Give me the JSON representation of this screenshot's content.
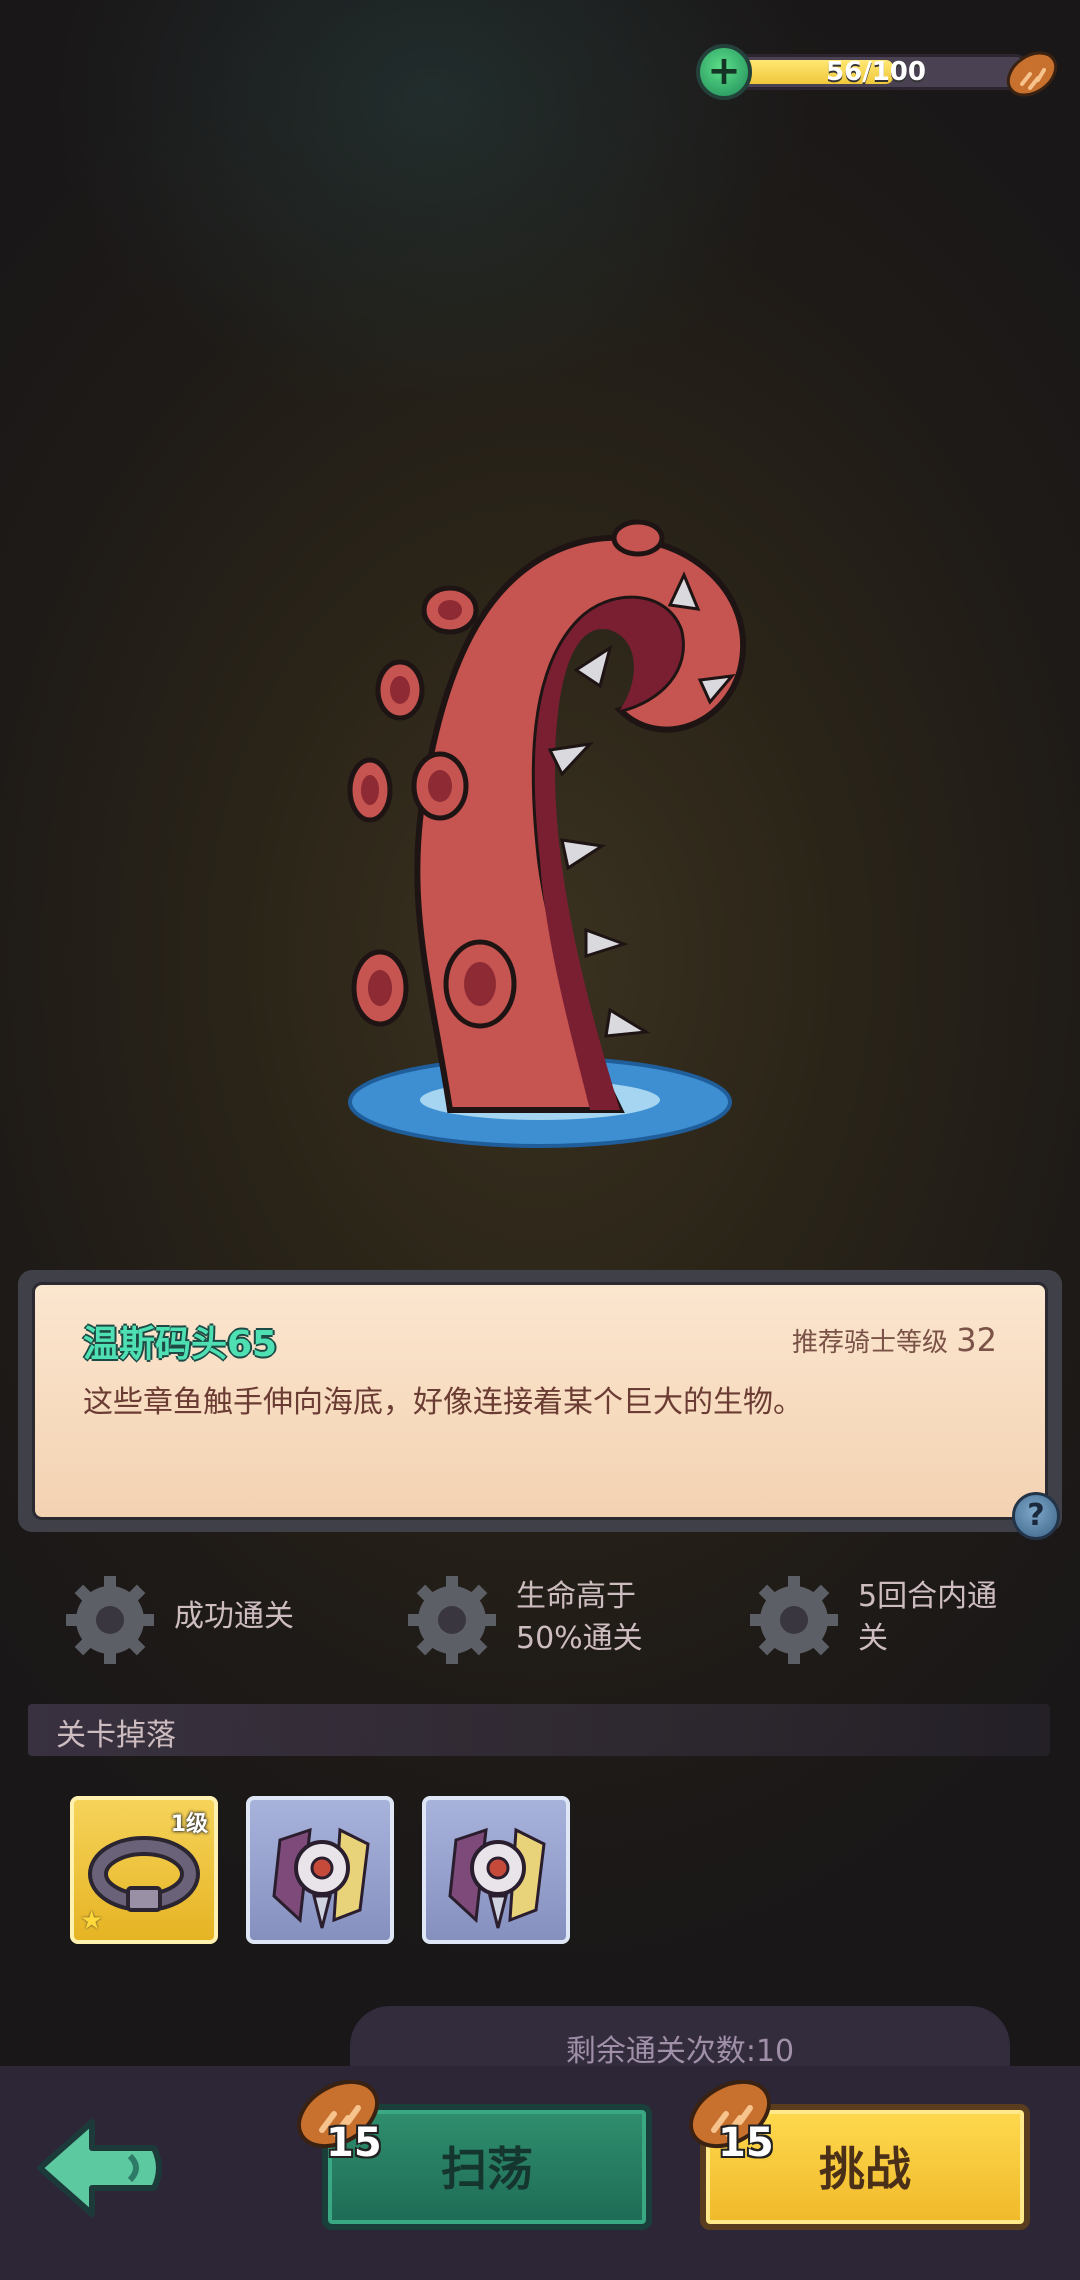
{
  "stamina": {
    "value_text": "56/100",
    "current": 56,
    "max": 100,
    "plus_label": "+"
  },
  "stage": {
    "name": "温斯码头65",
    "recommend_label": "推荐骑士等级",
    "recommend_level": "32",
    "description": "这些章鱼触手伸向海底，好像连接着某个巨大的生物。",
    "help_label": "?"
  },
  "conditions": [
    {
      "text_line1": "成功通关",
      "text_line2": ""
    },
    {
      "text_line1": "生命高于",
      "text_line2": "50%通关"
    },
    {
      "text_line1": "5回合内通",
      "text_line2": "关"
    }
  ],
  "drops": {
    "header": "关卡掉落",
    "items": [
      {
        "name": "belt",
        "level": "1级",
        "rarity": "gold",
        "star": "★"
      },
      {
        "name": "cloak-pendant",
        "rarity": "blue"
      },
      {
        "name": "cloak-pendant",
        "rarity": "blue"
      }
    ]
  },
  "footer": {
    "remaining_text": "剩余通关次数:10",
    "sweep": {
      "label": "扫荡",
      "cost": "15"
    },
    "challenge": {
      "label": "挑战",
      "cost": "15"
    }
  },
  "colors": {
    "stage_name": "#4ee0b2",
    "sweep_button": "#2f8f6e",
    "challenge_button": "#ffd94e",
    "stamina_fill": "#f0c73a"
  }
}
